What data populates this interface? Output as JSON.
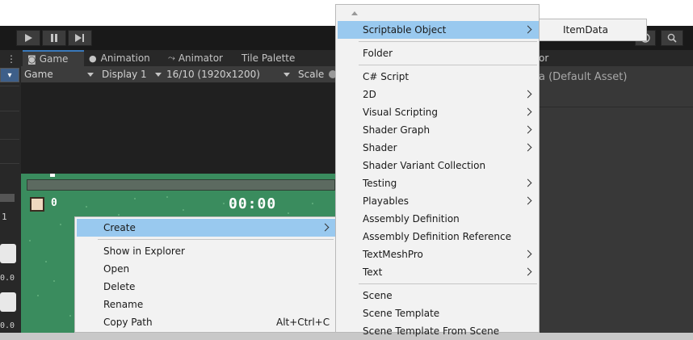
{
  "toolbar": {
    "play_icon": "play-icon",
    "pause_icon": "pause-icon",
    "step_icon": "step-icon",
    "search_icon": "search-icon"
  },
  "tabs": {
    "game": "Game",
    "animation": "Animation",
    "animator": "Animator",
    "tile_palette": "Tile Palette"
  },
  "game_bar": {
    "mode": "Game",
    "display": "Display 1",
    "resolution": "16/10 (1920x1200)",
    "scale_label": "Scale"
  },
  "game_view": {
    "score": "0",
    "timer": "00:00",
    "left_numbers": [
      "1",
      "0.0",
      "0.0"
    ]
  },
  "inspector": {
    "tab_partial": "or",
    "asset_text": "a (Default Asset)"
  },
  "context_menu": {
    "items": [
      {
        "label": "Create",
        "submenu": true,
        "highlighted": true
      },
      {
        "label": "Show in Explorer"
      },
      {
        "label": "Open"
      },
      {
        "label": "Delete"
      },
      {
        "label": "Rename"
      },
      {
        "label": "Copy Path",
        "shortcut": "Alt+Ctrl+C"
      }
    ]
  },
  "create_menu": {
    "items": [
      {
        "label": "Scriptable Object",
        "submenu": true,
        "highlighted": true
      },
      {
        "label": "Folder"
      },
      {
        "label": "C# Script"
      },
      {
        "label": "2D",
        "submenu": true
      },
      {
        "label": "Visual Scripting",
        "submenu": true
      },
      {
        "label": "Shader Graph",
        "submenu": true
      },
      {
        "label": "Shader",
        "submenu": true
      },
      {
        "label": "Shader Variant Collection"
      },
      {
        "label": "Testing",
        "submenu": true
      },
      {
        "label": "Playables",
        "submenu": true
      },
      {
        "label": "Assembly Definition"
      },
      {
        "label": "Assembly Definition Reference"
      },
      {
        "label": "TextMeshPro",
        "submenu": true
      },
      {
        "label": "Text",
        "submenu": true
      },
      {
        "label": "Scene"
      },
      {
        "label": "Scene Template"
      },
      {
        "label": "Scene Template From Scene"
      }
    ]
  },
  "scriptable_menu": {
    "items": [
      {
        "label": "ItemData"
      }
    ]
  }
}
